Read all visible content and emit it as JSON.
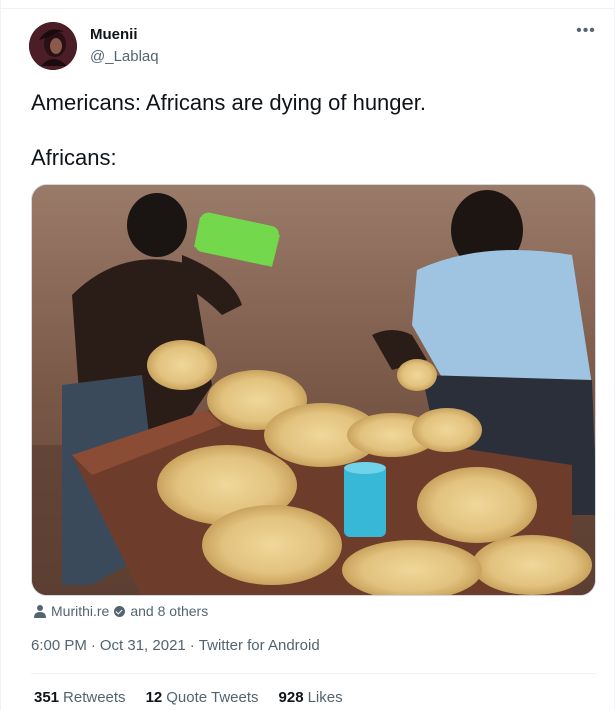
{
  "author": {
    "display_name": "Muenii",
    "handle": "@_Lablaq"
  },
  "tweet": {
    "line1": "Americans: Africans are dying of hunger.",
    "line2": "Africans:"
  },
  "photo": {
    "description_icon": "photo"
  },
  "tagged": {
    "icon": "person-icon",
    "name": "Murithi.re",
    "others": "and 8 others"
  },
  "meta": {
    "time": "6:00 PM",
    "separator1": "·",
    "date": "Oct 31, 2021",
    "separator2": "·",
    "source": "Twitter for Android"
  },
  "stats": {
    "retweets_count": "351",
    "retweets_label": "Retweets",
    "quotes_count": "12",
    "quotes_label": "Quote Tweets",
    "likes_count": "928",
    "likes_label": "Likes"
  },
  "colors": {
    "text_primary": "#0f1419",
    "text_secondary": "#536471",
    "border": "#eff3f4"
  }
}
